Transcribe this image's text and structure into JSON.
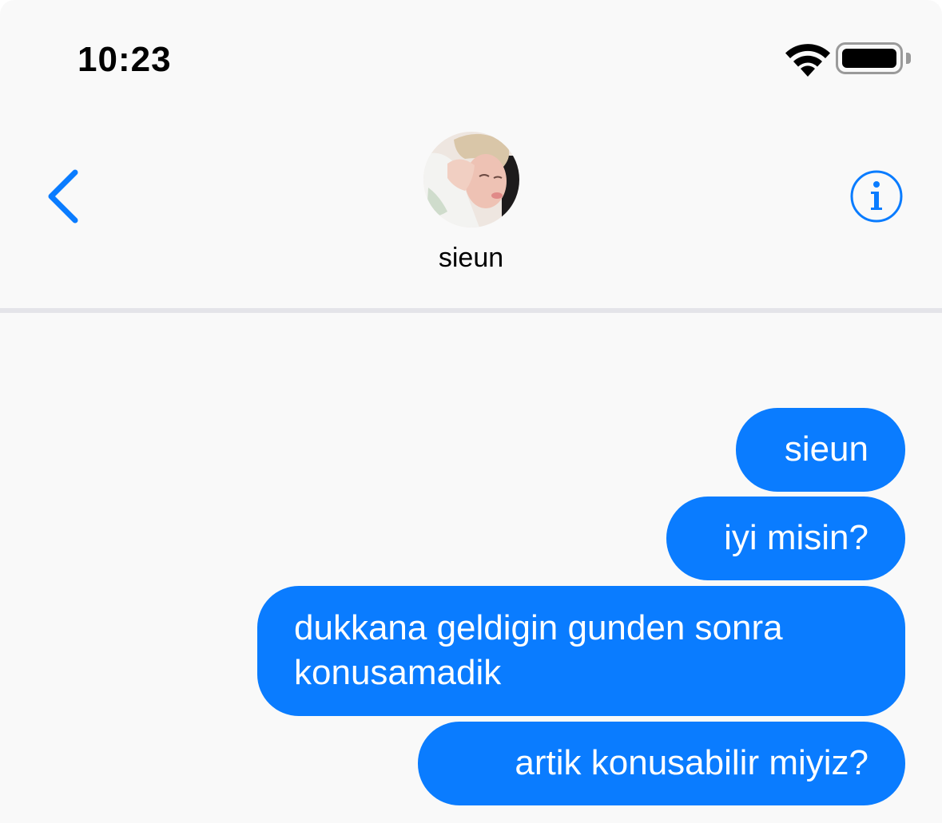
{
  "status_bar": {
    "time": "10:23"
  },
  "header": {
    "contact_name": "sieun",
    "back_icon": "chevron-left-icon",
    "info_icon": "info-circle-icon"
  },
  "messages": [
    {
      "text": "sieun"
    },
    {
      "text": "iyi misin?"
    },
    {
      "text": "dukkana geldigin gunden sonra konusamadik"
    },
    {
      "text": "artik konusabilir miyiz?"
    }
  ],
  "colors": {
    "accent": "#0a7cff",
    "background": "#f9f9f9",
    "divider": "#e4e4e9"
  }
}
